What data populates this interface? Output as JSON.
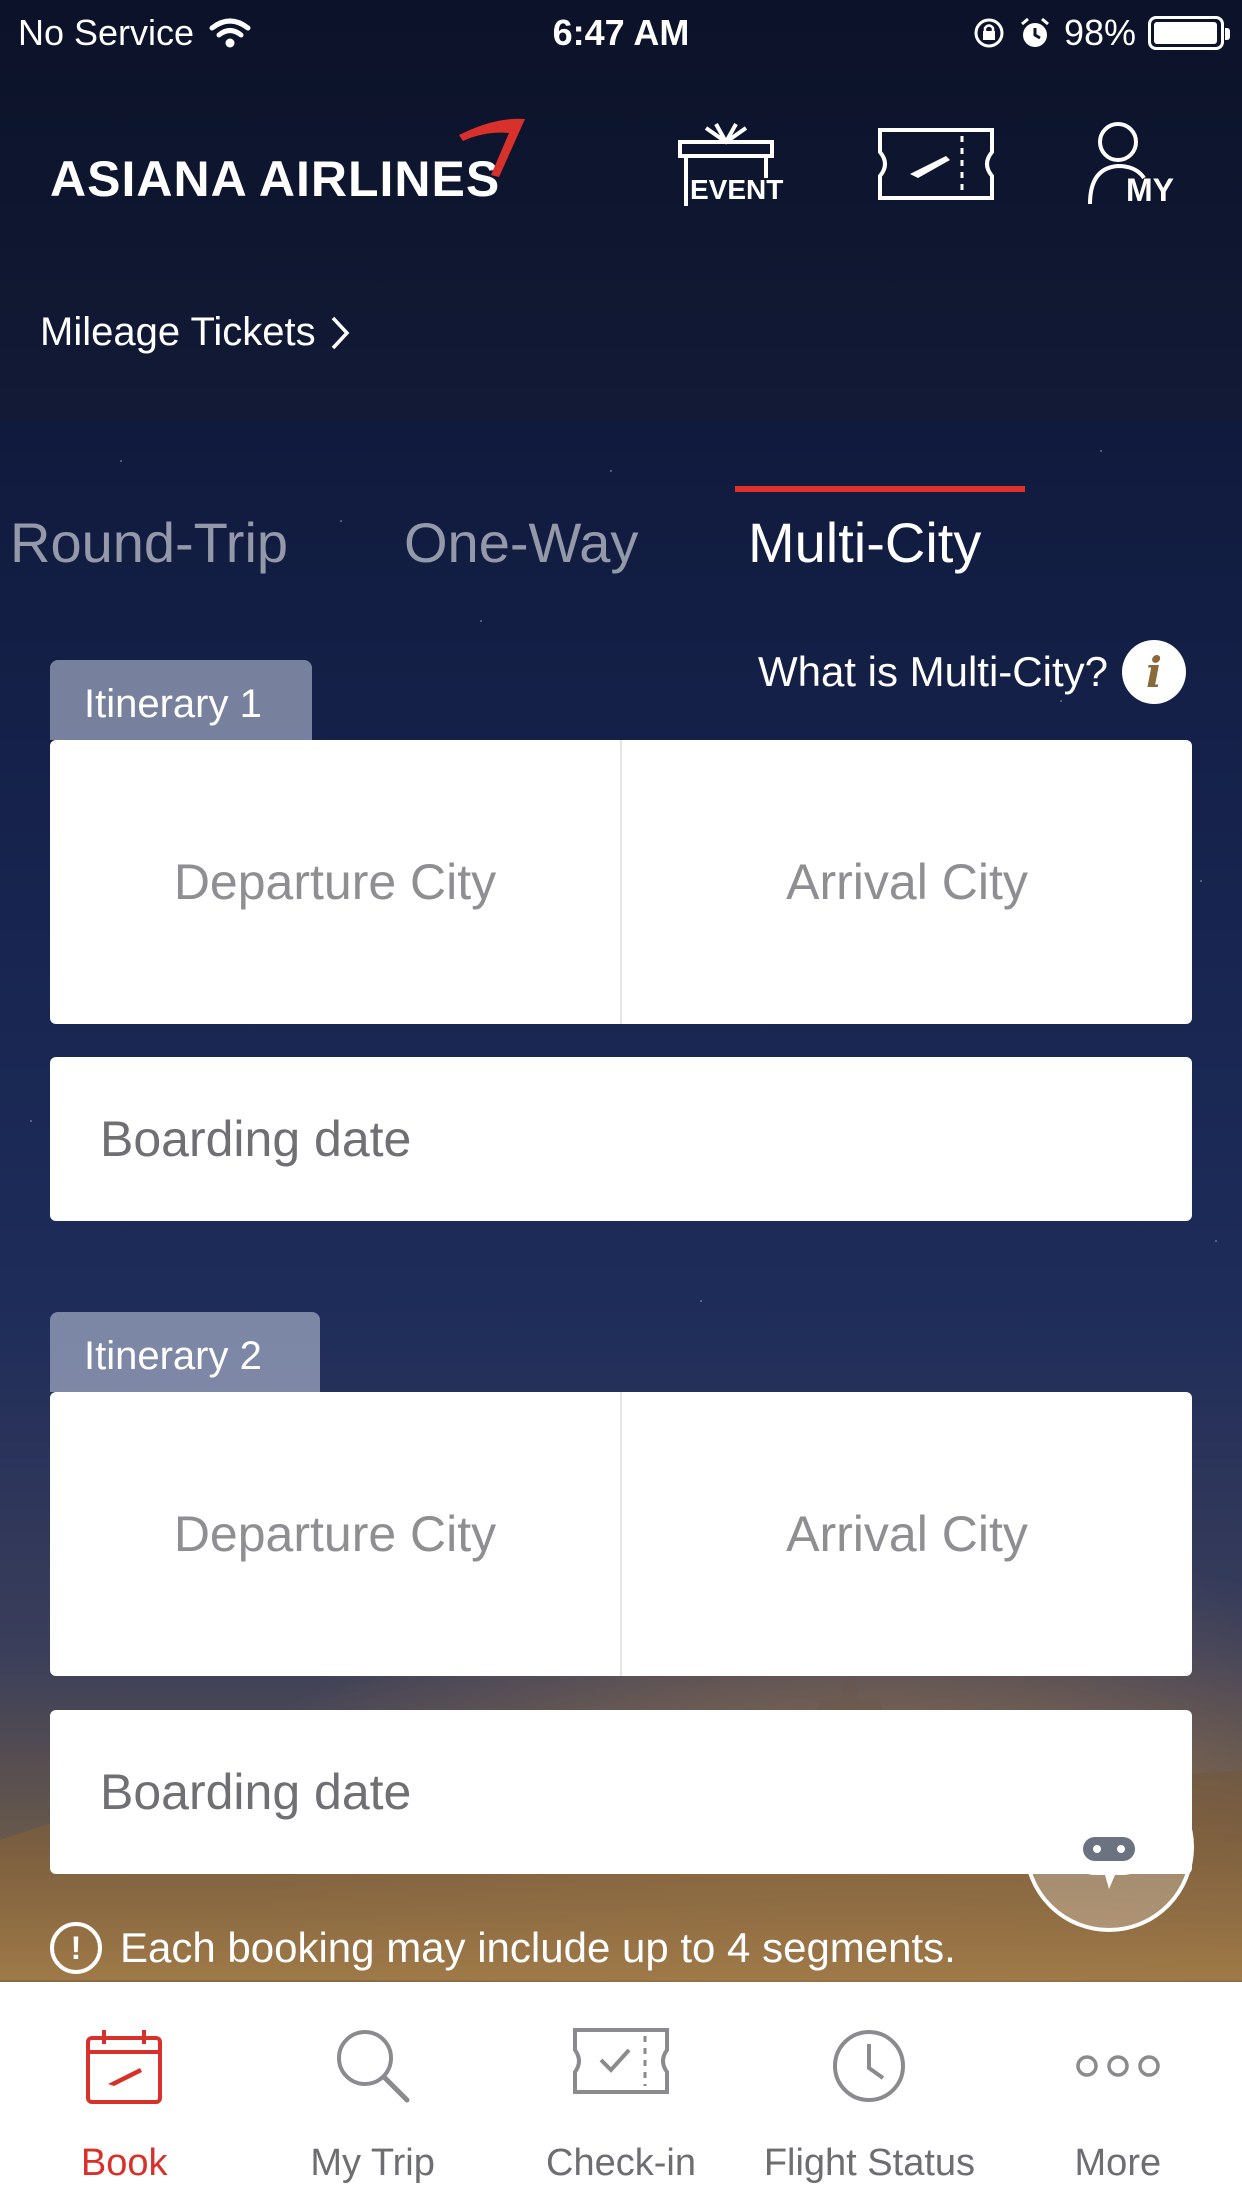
{
  "status_bar": {
    "carrier": "No Service",
    "time": "6:47 AM",
    "battery_percent": "98%",
    "battery_level": 0.98
  },
  "header": {
    "logo_text": "ASIANA AIRLINES",
    "event_label": "EVENT",
    "my_label": "MY",
    "mileage_link": "Mileage Tickets"
  },
  "tabs": [
    {
      "label": "Round-Trip",
      "active": false
    },
    {
      "label": "One-Way",
      "active": false
    },
    {
      "label": "Multi-City",
      "active": true
    }
  ],
  "what_is_multicity": "What is Multi-City?",
  "itineraries": [
    {
      "label": "Itinerary 1",
      "departure_placeholder": "Departure City",
      "arrival_placeholder": "Arrival City",
      "date_placeholder": "Boarding date"
    },
    {
      "label": "Itinerary 2",
      "departure_placeholder": "Departure City",
      "arrival_placeholder": "Arrival City",
      "date_placeholder": "Boarding date"
    }
  ],
  "notice": "Each booking may include up to 4 segments.",
  "bottom_nav": [
    {
      "label": "Book",
      "icon": "calendar-plane-icon",
      "active": true
    },
    {
      "label": "My Trip",
      "icon": "search-icon",
      "active": false
    },
    {
      "label": "Check-in",
      "icon": "checkin-icon",
      "active": false
    },
    {
      "label": "Flight Status",
      "icon": "clock-icon",
      "active": false
    },
    {
      "label": "More",
      "icon": "more-icon",
      "active": false
    }
  ],
  "colors": {
    "accent": "#d8302b",
    "background": "#0d1634",
    "placeholder": "#8e8e93"
  }
}
